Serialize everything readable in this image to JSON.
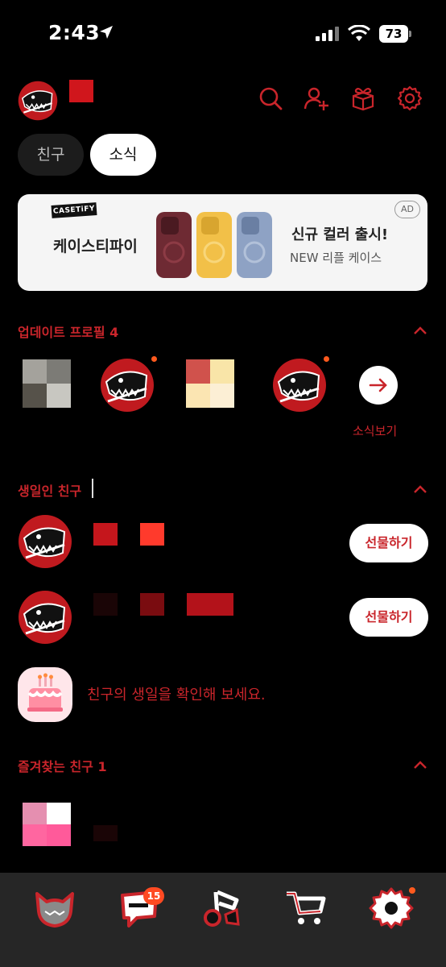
{
  "status_bar": {
    "time": "2:43",
    "battery": "73"
  },
  "header": {
    "icons": [
      "search-icon",
      "add-friend-icon",
      "gift-icon",
      "settings-icon"
    ]
  },
  "tabs": [
    {
      "label": "친구",
      "active": false
    },
    {
      "label": "소식",
      "active": true
    }
  ],
  "ad": {
    "brand_logo": "CASETiFY",
    "brand": "케이스티파이",
    "headline": "신규 컬러 출시!",
    "subtext": "NEW 리플 케이스",
    "badge": "AD"
  },
  "updated_profiles": {
    "title": "업데이트 프로필 4",
    "more_label": "소식보기"
  },
  "birthdays": {
    "title": "생일인 친구",
    "gift_label": "선물하기",
    "check_message": "친구의 생일을 확인해 보세요."
  },
  "favorites": {
    "title": "즐겨찾는 친구 1"
  },
  "tab_bar": {
    "items": [
      "friends-icon",
      "chats-icon",
      "music-icon",
      "shopping-icon",
      "more-settings-icon"
    ],
    "chat_badge": "15"
  },
  "colors": {
    "accent": "#c9252b",
    "background": "#000000",
    "tab_bar": "#262626"
  }
}
